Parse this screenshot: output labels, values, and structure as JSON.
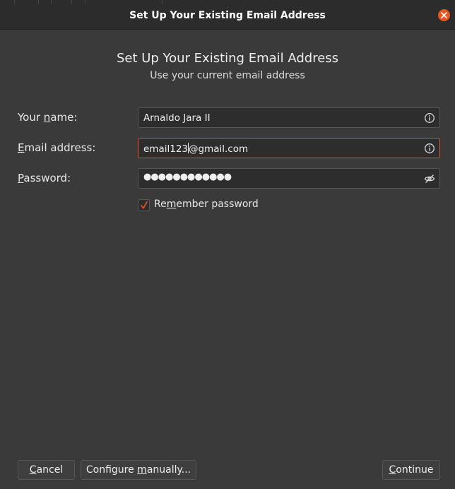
{
  "window": {
    "title": "Set Up Your Existing Email Address"
  },
  "header": {
    "title": "Set Up Your Existing Email Address",
    "subtitle": "Use your current email address"
  },
  "form": {
    "name": {
      "label_pre": "Your ",
      "label_u": "n",
      "label_post": "ame:",
      "value": "Arnaldo Jara II"
    },
    "email": {
      "label_pre": "",
      "label_u": "E",
      "label_post": "mail address:",
      "value_before_caret": "email123",
      "value_after_caret": "@gmail.com"
    },
    "password": {
      "label_pre": "",
      "label_u": "P",
      "label_post": "assword:",
      "value": "●●●●●●●●●●●●"
    },
    "remember": {
      "label_pre": "Re",
      "label_u": "m",
      "label_post": "ember password",
      "checked": true
    }
  },
  "buttons": {
    "cancel": {
      "pre": "",
      "u": "C",
      "post": "ancel"
    },
    "manual": {
      "pre": "Configure ",
      "u": "m",
      "post": "anually..."
    },
    "continue": {
      "pre": "",
      "u": "C",
      "post": "ontinue"
    }
  },
  "colors": {
    "accent": "#e95420",
    "background": "#3a3a3a",
    "field": "#2d2d2d"
  },
  "icons": [
    "close-icon",
    "info-icon",
    "eye-slash-icon",
    "checkmark-icon"
  ]
}
